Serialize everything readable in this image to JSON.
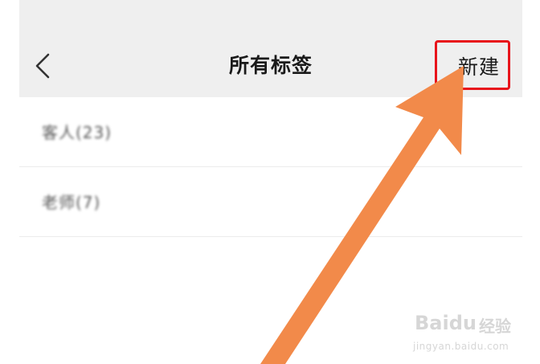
{
  "nav": {
    "title": "所有标签",
    "new_label": "新建"
  },
  "tags": [
    {
      "label": "客人(23)"
    },
    {
      "label": "老师(7)"
    }
  ],
  "annotation": {
    "highlight_color": "#e8141b",
    "arrow_color": "#f28a4a"
  },
  "watermark": {
    "logo_text": "Baidu",
    "jingyan_text": "经验",
    "url": "jingyan.baidu.com"
  }
}
